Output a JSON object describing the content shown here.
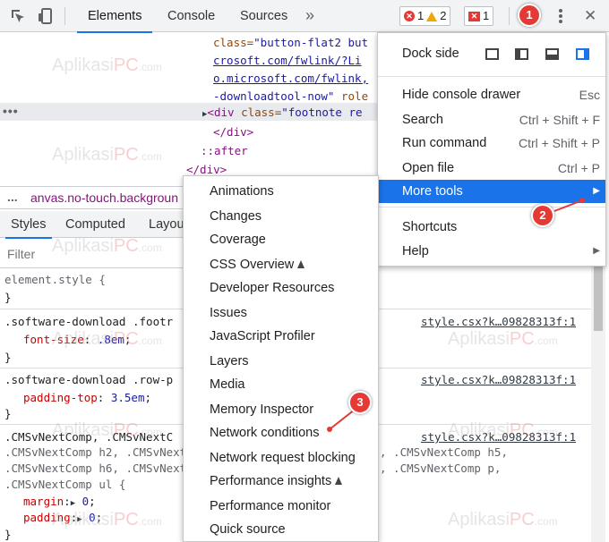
{
  "toolbar": {
    "tabs": [
      {
        "label": "Elements",
        "active": true
      },
      {
        "label": "Console",
        "active": false
      },
      {
        "label": "Sources",
        "active": false
      }
    ],
    "more_tabs_glyph": "»",
    "errors_count": "1",
    "warnings_count": "2",
    "messages_count": "1",
    "close_glyph": "✕"
  },
  "dom": {
    "lines": [
      {
        "attr_part": "class=",
        "val_part": "\"button-flat2 but"
      },
      {
        "link": "crosoft.com/fwlink/?Li"
      },
      {
        "link": "o.microsoft.com/fwlink,"
      },
      {
        "val_part": "-downloadtool-now\"",
        "attr_part": " role"
      },
      {
        "selected_tag": "<div ",
        "selected_attr": "class=",
        "selected_val": "\"footnote re"
      },
      {
        "tag": "</div>"
      },
      {
        "pseudo": "::after"
      },
      {
        "tag": "</div>"
      }
    ],
    "dots": "•••",
    "breadcrumb_dots": "...",
    "breadcrumb": "anvas.no-touch.backgroun"
  },
  "subtabs": [
    {
      "label": "Styles",
      "active": true
    },
    {
      "label": "Computed",
      "active": false
    },
    {
      "label": "Layou",
      "active": false
    }
  ],
  "filter": {
    "placeholder": "Filter"
  },
  "styles": {
    "element_style": "element.style {",
    "close_brace": "}",
    "rule1_selector": ".software-download .footr",
    "rule1_prop": "font-size",
    "rule1_val": ".8em",
    "rule2_selector": ".software-download .row-p",
    "rule2_prop": "padding-top",
    "rule2_val": "3.5em",
    "rule3_line1": ".CMSvNextComp, .CMSvNextC",
    "rule3_line2": ".CMSvNextComp h2, .CMSvNext",
    "rule3_line2_right": ", .CMSvNextComp h5,",
    "rule3_line3": ".CMSvNextComp h6, .CMSvNext",
    "rule3_line3_right": ", .CMSvNextComp p,",
    "rule3_line4": ".CMSvNextComp ul {",
    "margin_prop": "margin",
    "padding_prop": "padding",
    "zero": "0",
    "source": "style.csx?k…09828313f:1"
  },
  "main_menu": {
    "dock_side": "Dock side",
    "items": [
      {
        "label": "Hide console drawer",
        "shortcut": "Esc"
      },
      {
        "label": "Search",
        "shortcut": "Ctrl + Shift + F"
      },
      {
        "label": "Run command",
        "shortcut": "Ctrl + Shift + P"
      },
      {
        "label": "Open file",
        "shortcut": "Ctrl + P"
      },
      {
        "label": "More tools",
        "shortcut": "▶",
        "highlighted": true
      },
      {
        "label": "Shortcuts",
        "shortcut": ""
      },
      {
        "label": "Help",
        "shortcut": "▶"
      }
    ]
  },
  "more_tools": [
    {
      "label": "Animations"
    },
    {
      "label": "Changes"
    },
    {
      "label": "Coverage"
    },
    {
      "label": "CSS Overview",
      "experimental": true
    },
    {
      "label": "Developer Resources"
    },
    {
      "label": "Issues"
    },
    {
      "label": "JavaScript Profiler"
    },
    {
      "label": "Layers"
    },
    {
      "label": "Media"
    },
    {
      "label": "Memory Inspector"
    },
    {
      "label": "Network conditions"
    },
    {
      "label": "Network request blocking"
    },
    {
      "label": "Performance insights",
      "experimental": true
    },
    {
      "label": "Performance monitor"
    },
    {
      "label": "Quick source"
    }
  ],
  "callouts": [
    "1",
    "2",
    "3"
  ],
  "watermark": {
    "prefix": "Aplikasi",
    "accent": "PC",
    "suffix": ".com"
  },
  "colors": {
    "accent": "#1a73e8",
    "callout": "#e53935"
  }
}
